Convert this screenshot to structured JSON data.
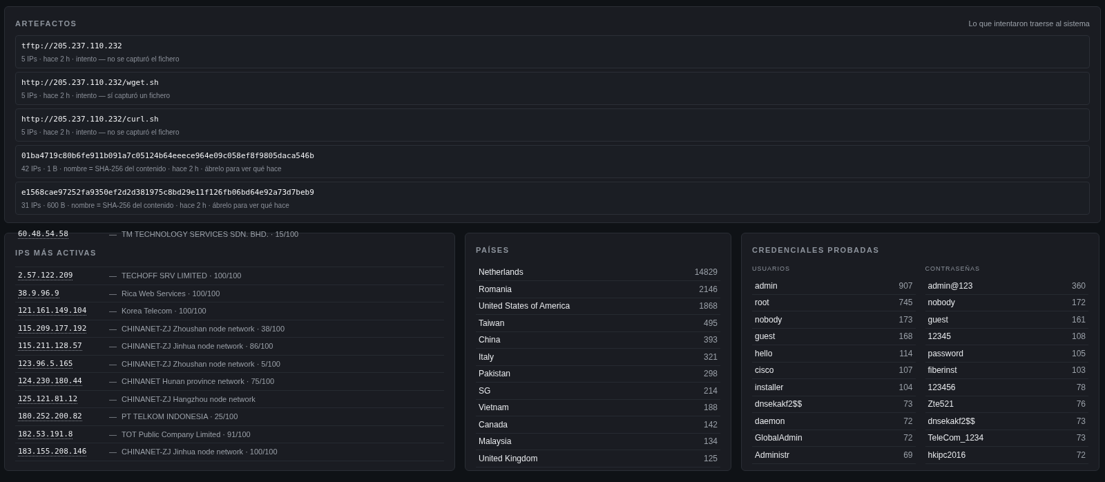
{
  "artefactos": {
    "title": "ARTEFACTOS",
    "subtitle": "Lo que intentaron traerse al sistema",
    "items": [
      {
        "name": "tftp://205.237.110.232",
        "meta": "5 IPs · hace 2 h · intento — no se capturó el fichero"
      },
      {
        "name": "http://205.237.110.232/wget.sh",
        "meta": "5 IPs · hace 2 h · intento — sí capturó un fichero"
      },
      {
        "name": "http://205.237.110.232/curl.sh",
        "meta": "5 IPs · hace 2 h · intento — no se capturó el fichero"
      },
      {
        "name": "01ba4719c80b6fe911b091a7c05124b64eeece964e09c058ef8f9805daca546b",
        "meta": "42 IPs · 1 B · nombre = SHA-256 del contenido · hace 2 h · ábrelo para ver qué hace"
      },
      {
        "name": "e1568cae97252fa9350ef2d2d381975c8bd29e11f126fb06bd64e92a73d7beb9",
        "meta": "31 IPs · 600 B · nombre = SHA-256 del contenido · hace 2 h · ábrelo para ver qué hace"
      }
    ]
  },
  "ips": {
    "title": "IPS MÁS ACTIVAS",
    "overflow_row": {
      "ip": "60.48.54.58",
      "sep": "—",
      "info": "TM TECHNOLOGY SERVICES SDN. BHD. · 15/100"
    },
    "rows": [
      {
        "ip": "2.57.122.209",
        "sep": "—",
        "info": "TECHOFF SRV LIMITED · 100/100"
      },
      {
        "ip": "38.9.96.9",
        "sep": "—",
        "info": "Rica Web Services · 100/100"
      },
      {
        "ip": "121.161.149.104",
        "sep": "—",
        "info": "Korea Telecom · 100/100"
      },
      {
        "ip": "115.209.177.192",
        "sep": "—",
        "info": "CHINANET-ZJ Zhoushan node network · 38/100"
      },
      {
        "ip": "115.211.128.57",
        "sep": "—",
        "info": "CHINANET-ZJ Jinhua node network · 86/100"
      },
      {
        "ip": "123.96.5.165",
        "sep": "—",
        "info": "CHINANET-ZJ Zhoushan node network · 5/100"
      },
      {
        "ip": "124.230.180.44",
        "sep": "—",
        "info": "CHINANET Hunan province network · 75/100"
      },
      {
        "ip": "125.121.81.12",
        "sep": "—",
        "info": "CHINANET-ZJ Hangzhou node network"
      },
      {
        "ip": "180.252.200.82",
        "sep": "—",
        "info": "PT TELKOM INDONESIA · 25/100"
      },
      {
        "ip": "182.53.191.8",
        "sep": "—",
        "info": "TOT Public Company Limited · 91/100"
      },
      {
        "ip": "183.155.208.146",
        "sep": "—",
        "info": "CHINANET-ZJ Jinhua node network · 100/100"
      }
    ]
  },
  "paises": {
    "title": "PAÍSES",
    "rows": [
      {
        "name": "Netherlands",
        "count": "14829"
      },
      {
        "name": "Romania",
        "count": "2146"
      },
      {
        "name": "United States of America",
        "count": "1868"
      },
      {
        "name": "Taiwan",
        "count": "495"
      },
      {
        "name": "China",
        "count": "393"
      },
      {
        "name": "Italy",
        "count": "321"
      },
      {
        "name": "Pakistan",
        "count": "298"
      },
      {
        "name": "SG",
        "count": "214"
      },
      {
        "name": "Vietnam",
        "count": "188"
      },
      {
        "name": "Canada",
        "count": "142"
      },
      {
        "name": "Malaysia",
        "count": "134"
      },
      {
        "name": "United Kingdom",
        "count": "125"
      }
    ]
  },
  "credenciales": {
    "title": "CREDENCIALES PROBADAS",
    "columns": [
      {
        "title": "USUARIOS",
        "rows": [
          {
            "name": "admin",
            "count": "907"
          },
          {
            "name": "root",
            "count": "745"
          },
          {
            "name": "nobody",
            "count": "173"
          },
          {
            "name": "guest",
            "count": "168"
          },
          {
            "name": "hello",
            "count": "114"
          },
          {
            "name": "cisco",
            "count": "107"
          },
          {
            "name": "installer",
            "count": "104"
          },
          {
            "name": "dnsekakf2$$",
            "count": "73"
          },
          {
            "name": "daemon",
            "count": "72"
          },
          {
            "name": "GlobalAdmin",
            "count": "72"
          },
          {
            "name": "Administr",
            "count": "69"
          }
        ]
      },
      {
        "title": "CONTRASEÑAS",
        "rows": [
          {
            "name": "admin@123",
            "count": "360"
          },
          {
            "name": "nobody",
            "count": "172"
          },
          {
            "name": "guest",
            "count": "161"
          },
          {
            "name": "12345",
            "count": "108"
          },
          {
            "name": "password",
            "count": "105"
          },
          {
            "name": "fiberinst",
            "count": "103"
          },
          {
            "name": "123456",
            "count": "78"
          },
          {
            "name": "Zte521",
            "count": "76"
          },
          {
            "name": "dnsekakf2$$",
            "count": "73"
          },
          {
            "name": "TeleCom_1234",
            "count": "73"
          },
          {
            "name": "hkipc2016",
            "count": "72"
          }
        ]
      }
    ]
  }
}
